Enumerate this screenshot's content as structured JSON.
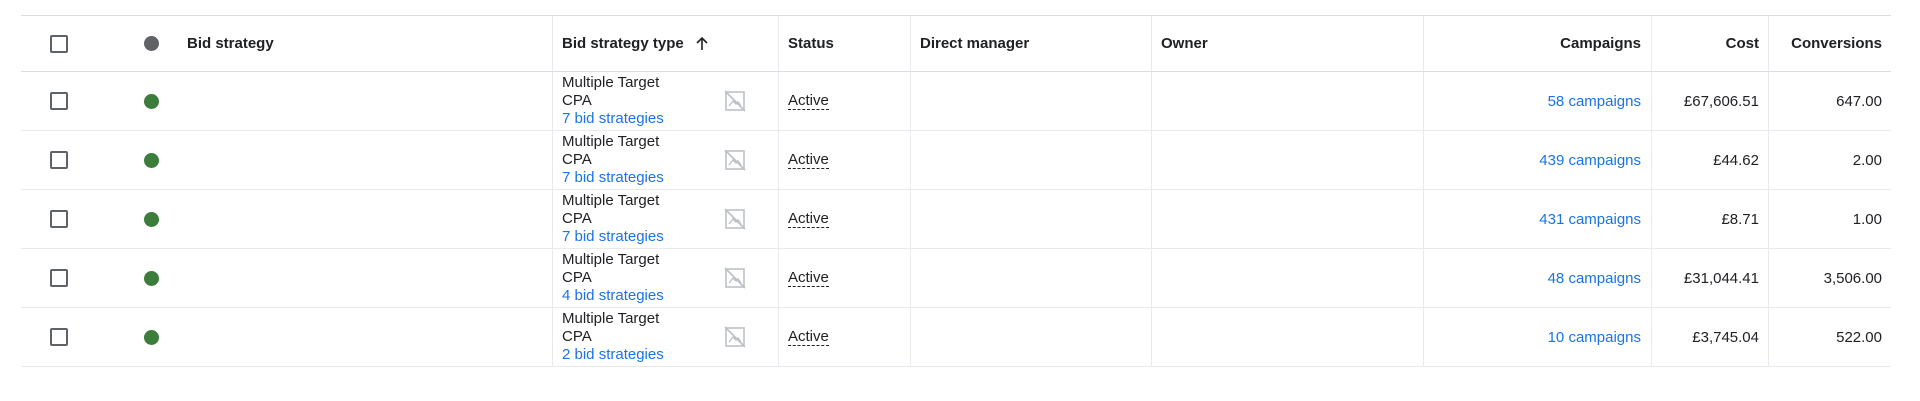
{
  "colors": {
    "enabled": "#3c7d3c",
    "header_dot": "#5f6368",
    "link": "#1a73e8"
  },
  "header": {
    "bid_strategy": "Bid strategy",
    "bid_strategy_type": "Bid strategy type",
    "status": "Status",
    "direct_manager": "Direct manager",
    "owner": "Owner",
    "campaigns": "Campaigns",
    "cost": "Cost",
    "conversions": "Conversions",
    "sort_icon": "arrow-up-icon"
  },
  "rows": [
    {
      "type_line1": "Multiple Target",
      "type_line2": "CPA",
      "type_link": "7 bid strategies",
      "status": "Active",
      "campaigns": "58 campaigns",
      "cost": "£67,606.51",
      "conversions": "647.00"
    },
    {
      "type_line1": "Multiple Target",
      "type_line2": "CPA",
      "type_link": "7 bid strategies",
      "status": "Active",
      "campaigns": "439 campaigns",
      "cost": "£44.62",
      "conversions": "2.00"
    },
    {
      "type_line1": "Multiple Target",
      "type_line2": "CPA",
      "type_link": "7 bid strategies",
      "status": "Active",
      "campaigns": "431 campaigns",
      "cost": "£8.71",
      "conversions": "1.00"
    },
    {
      "type_line1": "Multiple Target",
      "type_line2": "CPA",
      "type_link": "4 bid strategies",
      "status": "Active",
      "campaigns": "48 campaigns",
      "cost": "£31,044.41",
      "conversions": "3,506.00"
    },
    {
      "type_line1": "Multiple Target",
      "type_line2": "CPA",
      "type_link": "2 bid strategies",
      "status": "Active",
      "campaigns": "10 campaigns",
      "cost": "£3,745.04",
      "conversions": "522.00"
    }
  ]
}
